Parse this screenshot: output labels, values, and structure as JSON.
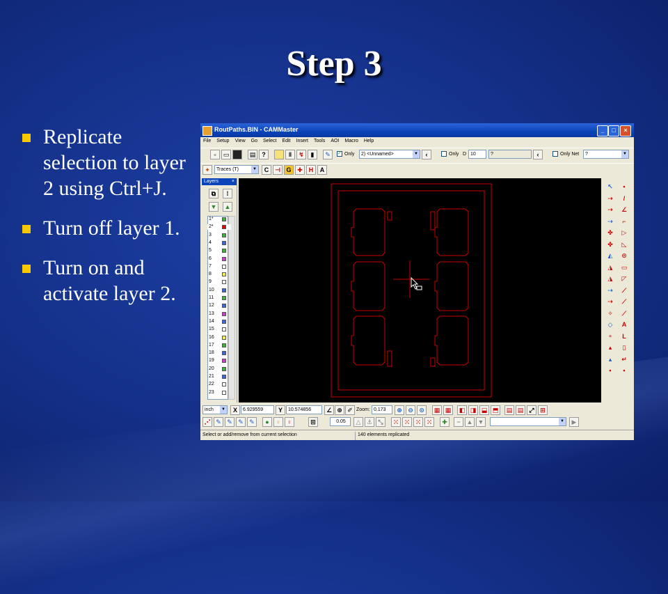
{
  "slide": {
    "title": "Step 3",
    "bullets": [
      "Replicate selection to layer 2 using Ctrl+J.",
      "Turn off layer 1.",
      "Turn on and activate layer 2."
    ]
  },
  "app": {
    "title": "RoutPaths.BIN - CAMMaster",
    "window_buttons": [
      "_",
      "□",
      "×"
    ],
    "menu": [
      "File",
      "Setup",
      "View",
      "Go",
      "Select",
      "Edit",
      "Insert",
      "Tools",
      "AOI",
      "Macro",
      "Help"
    ],
    "toolbar": {
      "only_label": "Only",
      "layer_select": "2) <Unnamed>",
      "only_d_label": "Only",
      "d_label": "D",
      "d_value": "10",
      "q_value": "?",
      "only_net_label": "Only Net",
      "net_value": "?",
      "traces_select": "Traces   (T)"
    },
    "layers_panel": {
      "title": "Layers",
      "close": "×",
      "rows": [
        {
          "num": "1*",
          "color": "#3cb43c"
        },
        {
          "num": "2*",
          "color": "#e00000"
        },
        {
          "num": "3",
          "color": "#3cb43c"
        },
        {
          "num": "4",
          "color": "#3c64dc"
        },
        {
          "num": "5",
          "color": "#3cb43c"
        },
        {
          "num": "6",
          "color": "#c83cc8"
        },
        {
          "num": "7",
          "color": "#ffffff"
        },
        {
          "num": "8",
          "color": "#f0f050"
        },
        {
          "num": "9",
          "color": "#ffffff"
        },
        {
          "num": "10",
          "color": "#3c64dc"
        },
        {
          "num": "11",
          "color": "#3cb43c"
        },
        {
          "num": "12",
          "color": "#3c64dc"
        },
        {
          "num": "13",
          "color": "#c83cc8"
        },
        {
          "num": "14",
          "color": "#3c64dc"
        },
        {
          "num": "15",
          "color": "#ffffff"
        },
        {
          "num": "16",
          "color": "#f0f050"
        },
        {
          "num": "17",
          "color": "#3cb43c"
        },
        {
          "num": "18",
          "color": "#3c64dc"
        },
        {
          "num": "19",
          "color": "#c83cc8"
        },
        {
          "num": "20",
          "color": "#3cb43c"
        },
        {
          "num": "21",
          "color": "#3c64dc"
        },
        {
          "num": "22",
          "color": "#ffffff"
        },
        {
          "num": "23",
          "color": "#ffffff"
        }
      ]
    },
    "coords": {
      "unit": "inch",
      "x_label": "X",
      "x_value": "6.929559",
      "y_label": "Y",
      "y_value": "10.574856",
      "zoom_label": "Zoom:",
      "zoom_value": "0.173",
      "grid_value": "0.05"
    },
    "status": {
      "left": "Select or add/remove from current selection",
      "right": "140 elements replicated"
    },
    "icons": {
      "right_toolbar": [
        "pointer-icon",
        "dot-icon",
        "line-icon",
        "angle-icon",
        "corner-icon",
        "arrow-icon",
        "triangle-icon",
        "circle-icon",
        "rectangle-icon",
        "slant-icon",
        "arc-icon",
        "curve-icon",
        "pen-icon",
        "text-icon",
        "italic-icon",
        "pad-icon",
        "hook-icon"
      ]
    },
    "trace_color": "#c80000"
  }
}
